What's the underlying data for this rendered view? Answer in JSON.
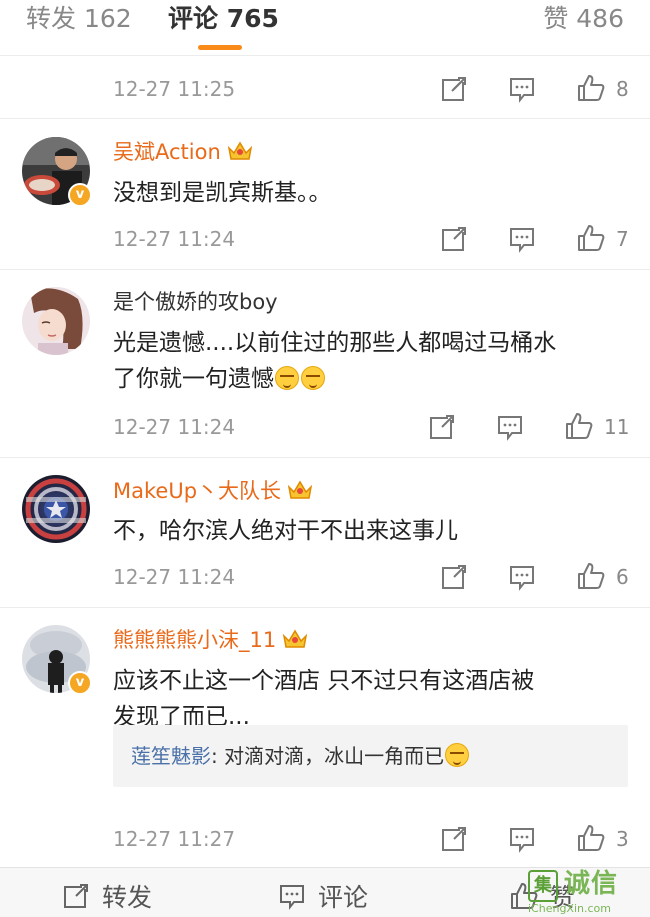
{
  "tabs": {
    "repost": "转发 162",
    "comments": "评论 765",
    "likes": "赞 486"
  },
  "comments": [
    {
      "time": "12-27 11:25",
      "likes": "8"
    },
    {
      "user": "吴斌Action",
      "text": "没想到是凯宾斯基。。",
      "time": "12-27 11:24",
      "likes": "7"
    },
    {
      "user": "是个傲娇的攻boy",
      "text_line1": "光是遗憾....以前住过的那些人都喝过马桶水",
      "text_line2": "了你就一句遗憾",
      "time": "12-27 11:24",
      "likes": "11"
    },
    {
      "user": "MakeUp丶大队长",
      "text": "不，哈尔滨人绝对干不出来这事儿",
      "time": "12-27 11:24",
      "likes": "6"
    },
    {
      "user": "熊熊熊熊小沫_11",
      "text_line1": "应该不止这一个酒店 只不过只有这酒店被",
      "text_line2": "发现了而已...",
      "reply_user": "莲笙魅影",
      "reply_text": ": 对滴对滴，冰山一角而已",
      "time": "12-27 11:27",
      "likes": "3"
    }
  ],
  "bottombar": {
    "repost": "转发",
    "comment": "评论",
    "like": "赞"
  },
  "watermark": {
    "logo": "集",
    "name": "诚信",
    "url": "iChengXin.com"
  },
  "colors": {
    "accent": "#f98a1a",
    "vip_name": "#e86a1a",
    "reply_user": "#4a71a8",
    "timestamp": "#999999"
  },
  "icons": [
    "share-icon",
    "comment-icon",
    "thumbs-up-icon",
    "crown-icon",
    "verified-badge-icon",
    "laugh-emoji-icon"
  ]
}
